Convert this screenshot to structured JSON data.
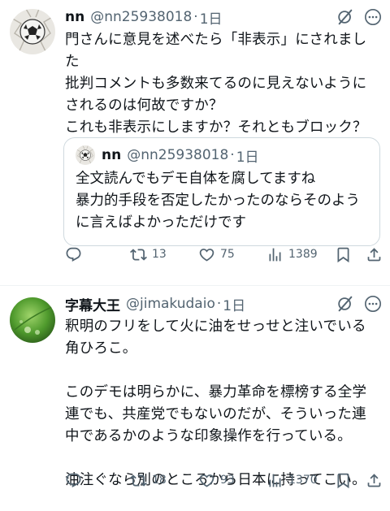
{
  "tweets": [
    {
      "name": "nn",
      "handle": "@nn25938018",
      "dot": "·",
      "time": "1日",
      "lines": [
        "門さんに意見を述べたら「非表示」にされまし",
        "た",
        "批判コメントも多数来てるのに見えないように",
        "されるのは何故ですか？",
        "これも非表示にしますか？それともブロック？"
      ],
      "quote": {
        "name": "nn",
        "handle": "@nn25938018",
        "dot": "·",
        "time": "1日",
        "lines": [
          "全文読んでもデモ自体を腐してますね",
          "暴力的手段を否定したかったのならそのよう",
          "に言えばよかっただけです"
        ]
      },
      "retweets": "13",
      "likes": "75",
      "views": "1389"
    },
    {
      "name": "字幕大王",
      "handle": "@jimakudaio",
      "dot": "·",
      "time": "1日",
      "lines": [
        "釈明のフリをして火に油をせっせと注いでいる",
        "角ひろこ。",
        "",
        "このデモは明らかに、暴力革命を標榜する全学",
        "連でも、共産党でもないのだが、そういった連",
        "中であるかのような印象操作を行っている。",
        "",
        "油注ぐなら別のところから日本に持ってこい。"
      ],
      "retweets": "18",
      "likes": "93",
      "views": "1370"
    }
  ],
  "icons": {
    "avatar1": "soccer-ball-cracked-wall-avatar",
    "avatar2": "green-leaf-avatar",
    "grok": "grok-icon",
    "more": "more-icon",
    "reply": "reply-icon",
    "retweet": "retweet-icon",
    "like": "like-icon",
    "views": "views-icon",
    "bookmark": "bookmark-icon",
    "share": "share-icon"
  },
  "colors": {
    "text": "#0f1419",
    "secondary": "#536471",
    "border": "#cfd9de",
    "divider": "#eff3f4"
  }
}
